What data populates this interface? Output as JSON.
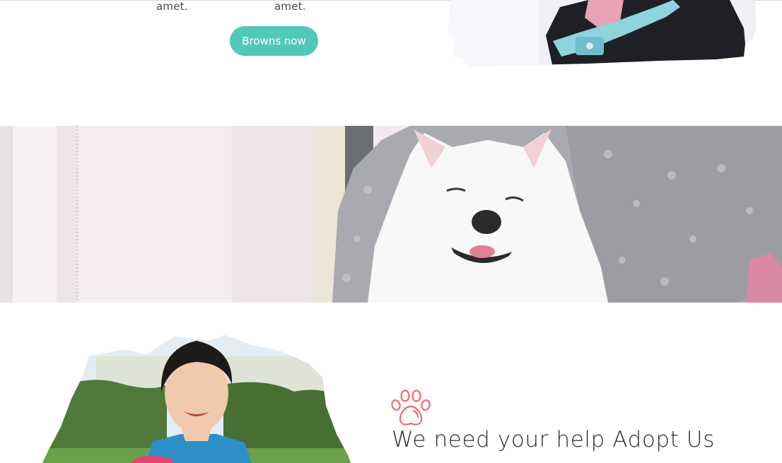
{
  "products": {
    "item_a_text_tail": "amet.",
    "item_b_text_tail": "amet."
  },
  "cta": {
    "label": "Browns now"
  },
  "adopt": {
    "title": "We need your help Adopt Us"
  },
  "icons": {
    "paw": "paw-icon"
  },
  "colors": {
    "accent": "#52c8b8",
    "paw": "#f06b6b",
    "heading": "#2d2d2d"
  }
}
